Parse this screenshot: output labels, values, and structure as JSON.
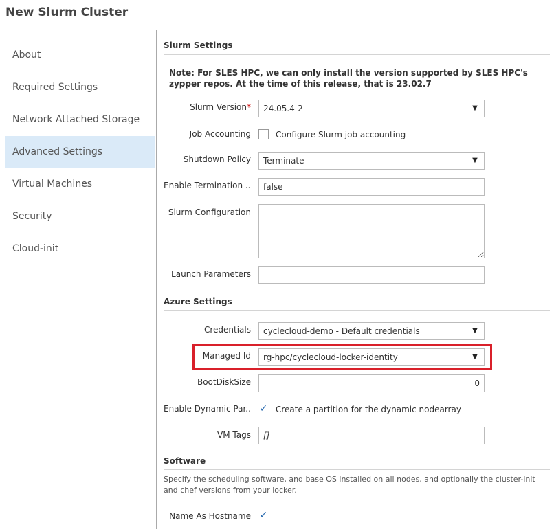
{
  "window": {
    "title": "New Slurm Cluster"
  },
  "sidebar": {
    "items": [
      {
        "label": "About"
      },
      {
        "label": "Required Settings"
      },
      {
        "label": "Network Attached Storage"
      },
      {
        "label": "Advanced Settings",
        "active": true
      },
      {
        "label": "Virtual Machines"
      },
      {
        "label": "Security"
      },
      {
        "label": "Cloud-init"
      }
    ]
  },
  "slurm_settings": {
    "heading": "Slurm Settings",
    "note": "Note: For SLES HPC, we can only install the version supported by SLES HPC's zypper repos. At the time of this release, that is 23.02.7",
    "slurm_version": {
      "label": "Slurm Version",
      "required_mark": "*",
      "value": "24.05.4-2"
    },
    "job_accounting": {
      "label": "Job Accounting",
      "checkbox_label": "Configure Slurm job accounting",
      "checked": false
    },
    "shutdown_policy": {
      "label": "Shutdown Policy",
      "value": "Terminate"
    },
    "enable_termination": {
      "label": "Enable Termination ...",
      "value": "false"
    },
    "slurm_configuration": {
      "label": "Slurm Configuration",
      "value": ""
    },
    "launch_parameters": {
      "label": "Launch Parameters",
      "value": ""
    }
  },
  "azure_settings": {
    "heading": "Azure Settings",
    "credentials": {
      "label": "Credentials",
      "value": "cyclecloud-demo - Default credentials"
    },
    "managed_id": {
      "label": "Managed Id",
      "value": "rg-hpc/cyclecloud-locker-identity"
    },
    "boot_disk_size": {
      "label": "BootDiskSize",
      "value": "0"
    },
    "enable_dynamic_partition": {
      "label": "Enable Dynamic Par...",
      "checkbox_label": "Create a partition for the dynamic nodearray",
      "checked": true
    },
    "vm_tags": {
      "label": "VM Tags",
      "value": "[]"
    }
  },
  "software": {
    "heading": "Software",
    "description": "Specify the scheduling software, and base OS installed on all nodes, and optionally the cluster-init and chef versions from your locker.",
    "name_as_hostname": {
      "label": "Name As Hostname",
      "checked": true
    }
  },
  "icons": {
    "dropdown": "chevron-down-icon",
    "check": "checkmark-icon"
  },
  "colors": {
    "active_nav_bg": "#daeaf8",
    "highlight_border": "#d9202a",
    "required": "#cc0000",
    "check": "#2b6cb0"
  }
}
